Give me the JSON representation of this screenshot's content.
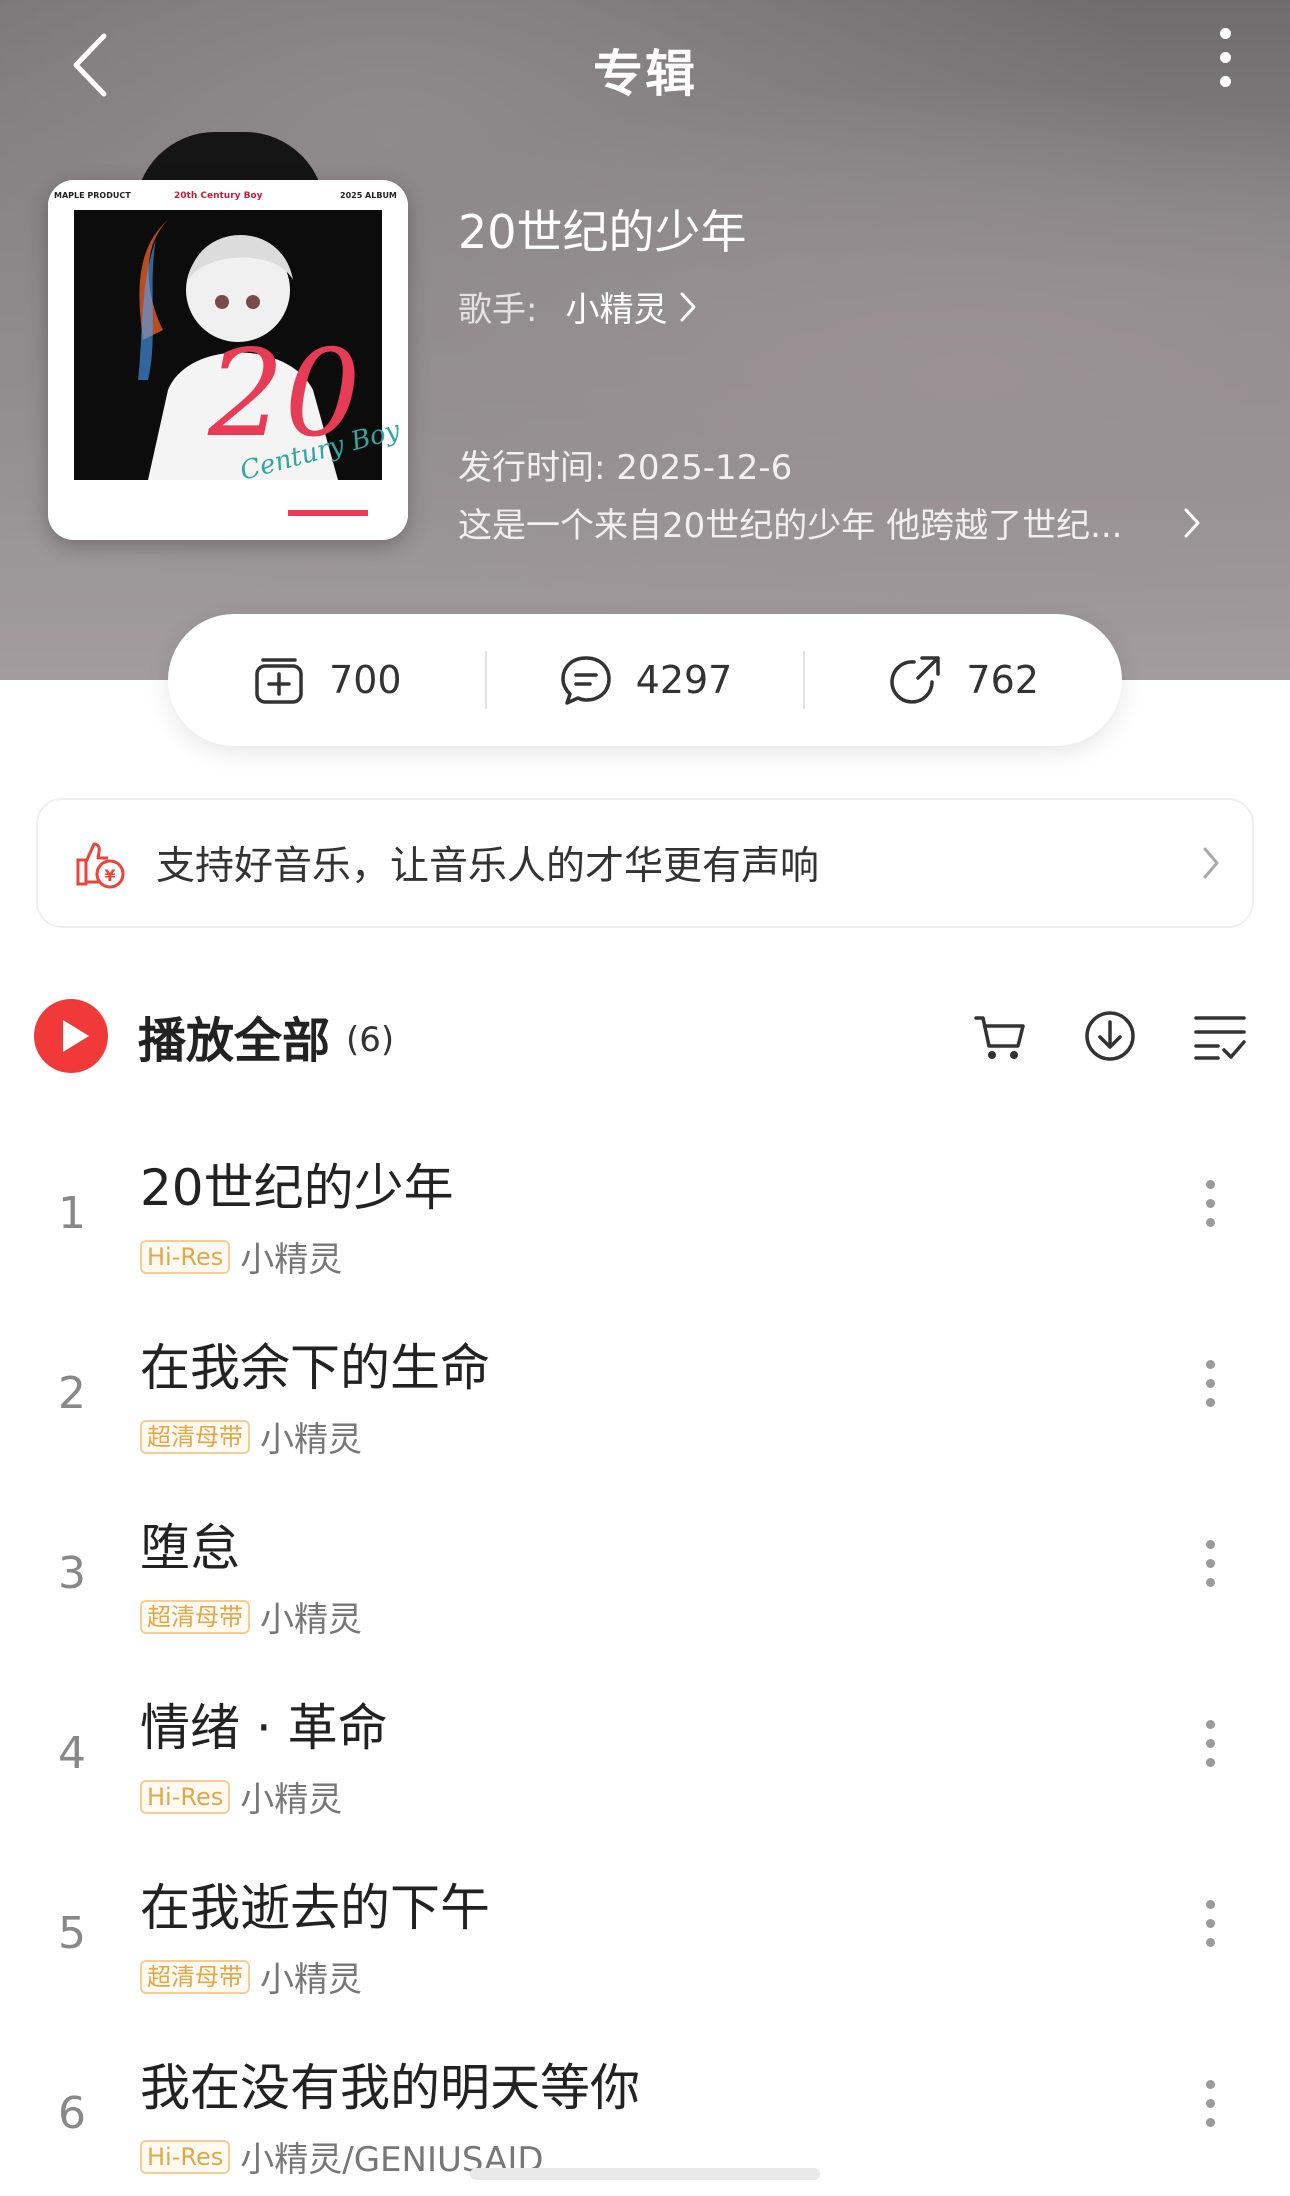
{
  "header": {
    "title": "专辑"
  },
  "album": {
    "name": "20世纪的少年",
    "artist_label": "歌手:",
    "artist": "小精灵",
    "release": "发行时间: 2025-12-6",
    "description": "这是一个来自20世纪的少年 他跨越了世纪...",
    "cover": {
      "top_left": "MAPLE PRODUCT",
      "top_center": "20th Century Boy",
      "top_right": "2025 ALBUM",
      "big": "20",
      "script": "Century Boy"
    }
  },
  "stats": {
    "collect": "700",
    "comments": "4297",
    "shares": "762"
  },
  "support": {
    "text": "支持好音乐，让音乐人的才华更有声响"
  },
  "playall": {
    "label": "播放全部",
    "count": "(6)"
  },
  "tracks": [
    {
      "num": "1",
      "title": "20世纪的少年",
      "badge": "Hi-Res",
      "artist": "小精灵"
    },
    {
      "num": "2",
      "title": "在我余下的生命",
      "badge": "超清母带",
      "artist": "小精灵"
    },
    {
      "num": "3",
      "title": "堕怠",
      "badge": "超清母带",
      "artist": "小精灵"
    },
    {
      "num": "4",
      "title": "情绪 · 革命",
      "badge": "Hi-Res",
      "artist": "小精灵"
    },
    {
      "num": "5",
      "title": "在我逝去的下午",
      "badge": "超清母带",
      "artist": "小精灵"
    },
    {
      "num": "6",
      "title": "我在没有我的明天等你",
      "badge": "Hi-Res",
      "artist": "小精灵/GENIUSAID"
    }
  ],
  "colors": {
    "accent_red": "#f2393a",
    "badge_gold": "#e0a84a"
  }
}
